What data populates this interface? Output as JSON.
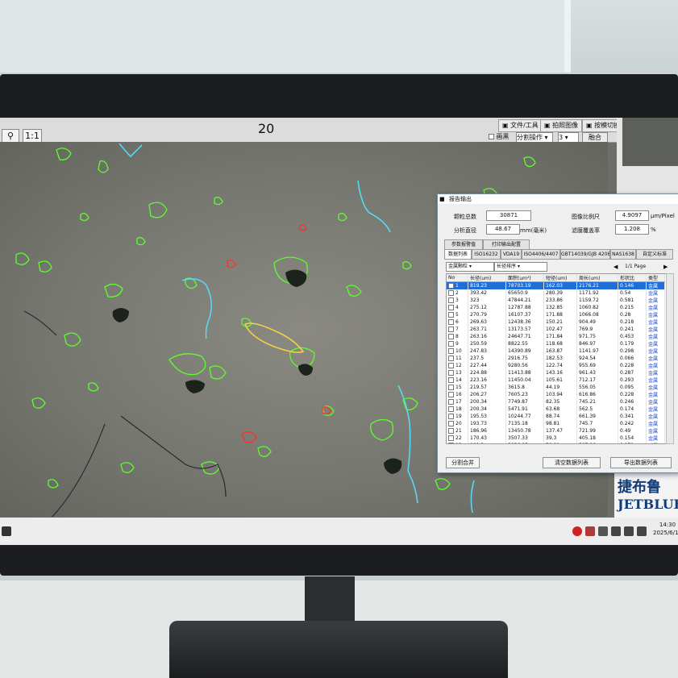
{
  "toolbar": {
    "zoom_label": "1:1",
    "frame_number": "20",
    "file_tools_label": "文件/工具",
    "photo_label": "拍照图像",
    "capture_switch_label": "按模切换",
    "checkbox_label": "画黑",
    "operation_select": "分割操作",
    "count_select": "3",
    "merge_label": "融合"
  },
  "dialog": {
    "title": "报告输出",
    "particle_count_label": "颗粒总数",
    "particle_count_value": "30871",
    "analysis_diameter_label": "分析直径",
    "analysis_diameter_value": "48.67",
    "analysis_diameter_unit": "mm(毫米)",
    "image_scale_label": "图像比例尺",
    "image_scale_value": "4.9097",
    "image_scale_unit": "μm/Pixel",
    "filter_coverage_label": "滤膜覆盖率",
    "filter_coverage_value": "1.208",
    "filter_coverage_unit": "%",
    "tabs_row1": [
      "参数报警值",
      "打印输出配置"
    ],
    "tabs_row2": [
      "数据列表",
      "ISO16232",
      "VDA19",
      "ISO4406/4407",
      "GBT14039/GJB 4208",
      "NAS1638",
      "自定义标准"
    ],
    "type_select": "金属颗粒",
    "sort_select": "长径排序",
    "page_label": "1/1 Page",
    "columns": [
      "No",
      "长径(um)",
      "面积(um²)",
      "短径(um)",
      "周长(um)",
      "形状比",
      "类型"
    ],
    "rows": [
      [
        "1",
        "819.23",
        "78703.19",
        "162.03",
        "2176.21",
        "0.146",
        "金属"
      ],
      [
        "2",
        "393.42",
        "65650.9",
        "280.39",
        "1171.92",
        "0.54",
        "金属"
      ],
      [
        "3",
        "323",
        "47844.21",
        "233.86",
        "1159.72",
        "0.581",
        "金属"
      ],
      [
        "4",
        "275.12",
        "12787.88",
        "132.85",
        "1060.82",
        "0.215",
        "金属"
      ],
      [
        "5",
        "270.79",
        "16107.37",
        "171.88",
        "1066.08",
        "0.28",
        "金属"
      ],
      [
        "6",
        "269.63",
        "12438.36",
        "150.21",
        "904.49",
        "0.218",
        "金属"
      ],
      [
        "7",
        "263.71",
        "13173.57",
        "102.47",
        "769.9",
        "0.241",
        "金属"
      ],
      [
        "8",
        "263.16",
        "24647.71",
        "171.84",
        "971.75",
        "0.453",
        "金属"
      ],
      [
        "9",
        "250.59",
        "8822.55",
        "118.68",
        "846.97",
        "0.179",
        "金属"
      ],
      [
        "10",
        "247.83",
        "14390.89",
        "163.87",
        "1141.97",
        "0.298",
        "金属"
      ],
      [
        "11",
        "237.5",
        "2916.75",
        "182.53",
        "924.54",
        "0.066",
        "金属"
      ],
      [
        "12",
        "227.44",
        "9280.56",
        "122.74",
        "955.69",
        "0.228",
        "金属"
      ],
      [
        "13",
        "224.88",
        "11413.88",
        "143.16",
        "961.43",
        "0.287",
        "金属"
      ],
      [
        "14",
        "223.16",
        "11450.04",
        "105.61",
        "712.17",
        "0.293",
        "金属"
      ],
      [
        "15",
        "219.57",
        "3615.8",
        "44.19",
        "556.05",
        "0.095",
        "金属"
      ],
      [
        "16",
        "206.27",
        "7605.23",
        "103.94",
        "616.86",
        "0.228",
        "金属"
      ],
      [
        "17",
        "200.34",
        "7749.87",
        "82.35",
        "745.21",
        "0.246",
        "金属"
      ],
      [
        "18",
        "200.34",
        "5471.91",
        "63.68",
        "562.5",
        "0.174",
        "金属"
      ],
      [
        "19",
        "195.53",
        "10244.77",
        "88.74",
        "661.39",
        "0.341",
        "金属"
      ],
      [
        "20",
        "193.73",
        "7135.18",
        "98.81",
        "745.7",
        "0.242",
        "金属"
      ],
      [
        "21",
        "186.96",
        "13450.78",
        "137.47",
        "721.99",
        "0.49",
        "金属"
      ],
      [
        "22",
        "170.43",
        "3507.33",
        "39.3",
        "405.18",
        "0.154",
        "金属"
      ],
      [
        "23",
        "169.3",
        "3856.85",
        "76.81",
        "567.26",
        "0.171",
        "金属"
      ],
      [
        "24",
        "160.3",
        "9425.19",
        "133.58",
        "278.24",
        "0.467",
        "金属"
      ]
    ],
    "btn_split_merge": "分割合并",
    "btn_clear_list": "清空数据列表",
    "btn_export_list": "导出数据列表"
  },
  "logo": {
    "cn": "捷布鲁",
    "en": "JETBLUE"
  },
  "taskbar": {
    "time": "14:30",
    "date": "2025/6/19"
  }
}
